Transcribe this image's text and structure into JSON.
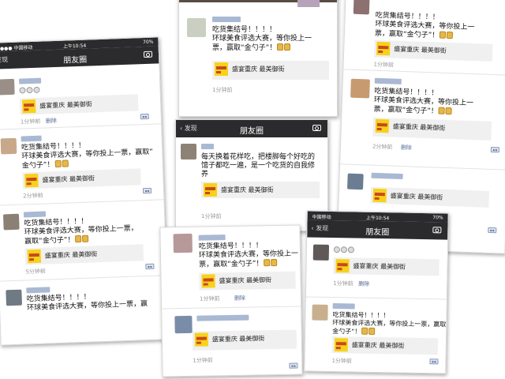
{
  "status": {
    "carrier": "●●●● 中国移动",
    "carrier_short": "中国移动",
    "time": "上午10:54",
    "battery": "70%"
  },
  "nav": {
    "back": "发现",
    "back_arrow": "‹ 发现",
    "title": "朋友圈"
  },
  "post": {
    "line1": "吃货集结号！！！！",
    "line2": "环球美食评选大赛，等你投上一票，",
    "line3": "赢取“金勺子”！",
    "narrow_line2": "环球美食评选大赛，等你投上一",
    "narrow_line3": "票，赢取“金勺子”！",
    "wide_line2": "环球美食评选大赛，等你投上一票，赢取“",
    "wide_line3": "金勺子”！",
    "tall_line2": "环球美食评选大赛，等你投上一票，",
    "tall_line3": "赢取“金勺子”！",
    "cut_line2": "环球美食评选大赛，等你投上一票，赢",
    "link_title": "盛宴重庆 最美御街"
  },
  "other_post": {
    "line1": "每天换着花样吃，把楼脚每个好吃的",
    "line2": "馆子都吃一遍，是一个吃货的自我修",
    "line3": "养"
  },
  "times": {
    "m1": "1分钟前",
    "m2": "2分钟前",
    "m5": "5分钟前",
    "delete": "删除"
  },
  "colors": {
    "navbar": "#2b2b2d",
    "link_blue": "#576b95",
    "card_bg": "#f0f0f0"
  },
  "icons": [
    "camera-icon",
    "back-arrow-icon",
    "comment-icon",
    "smiley-emoji-icon",
    "money-bag-emoji-icon"
  ]
}
